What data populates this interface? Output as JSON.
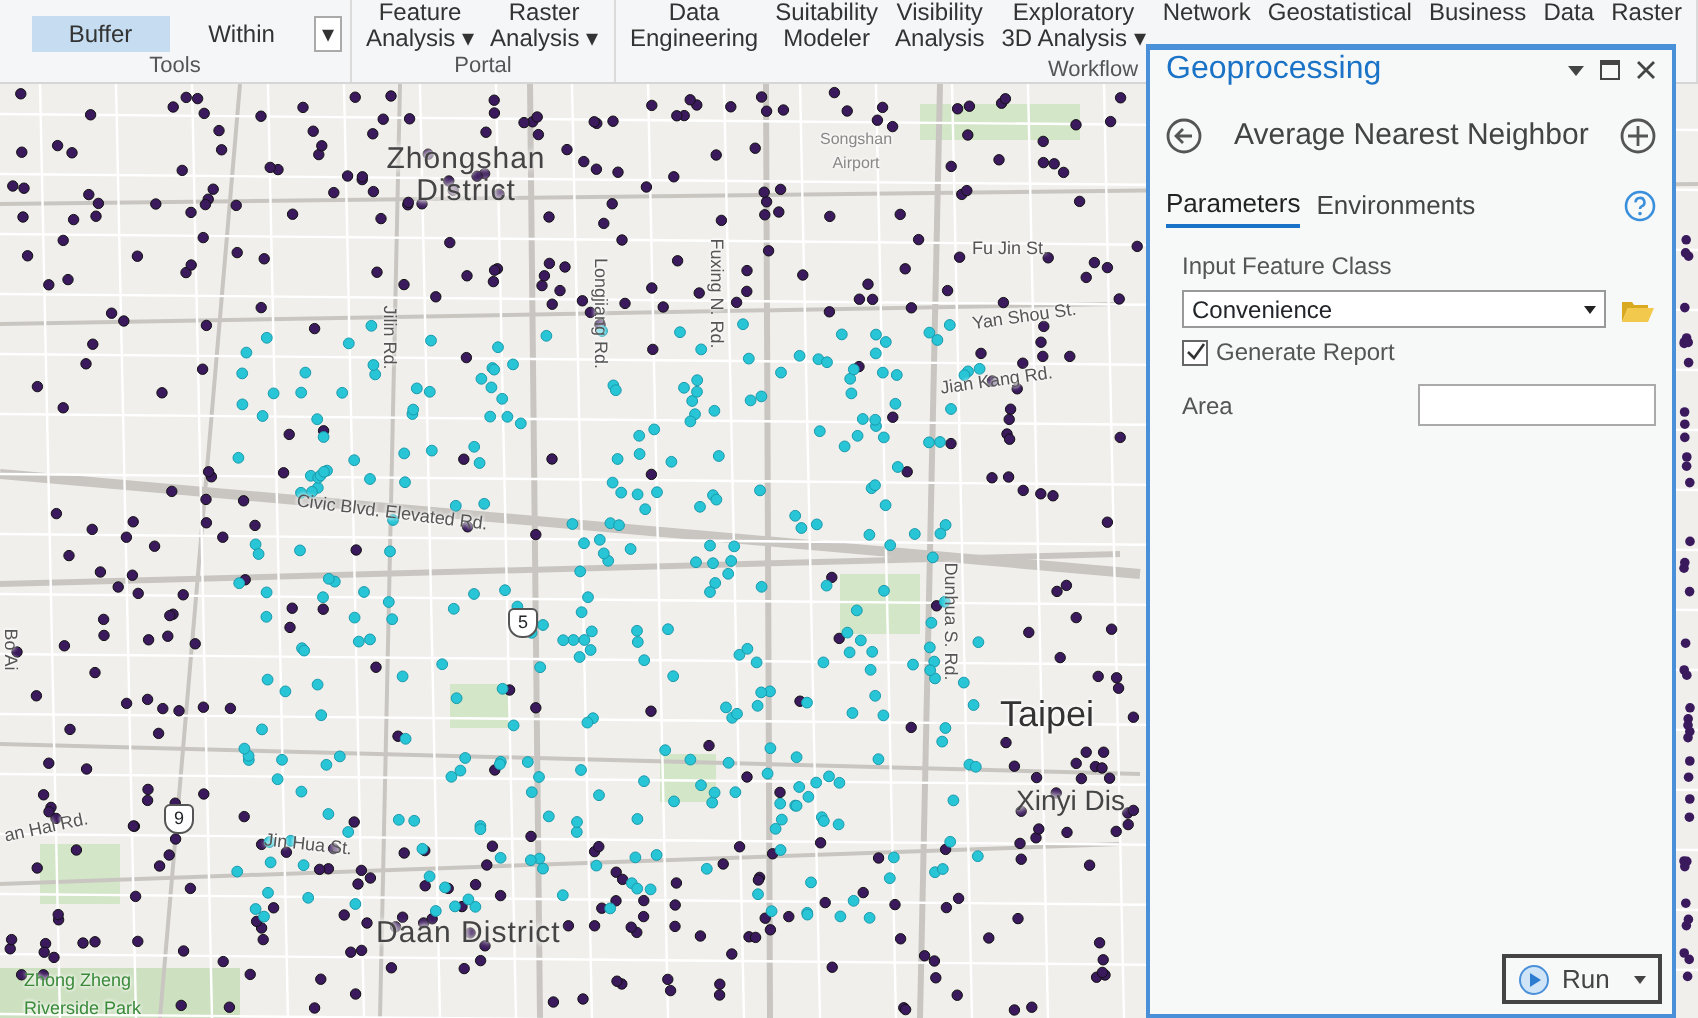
{
  "ribbon": {
    "groups": [
      {
        "label": "Tools",
        "buttons": [
          {
            "lines": [
              "Buffer"
            ],
            "selected": true
          },
          {
            "lines": [
              "Within"
            ],
            "selected": false
          }
        ],
        "gallery_more": "▾"
      },
      {
        "label": "Portal",
        "buttons": [
          {
            "lines": [
              "Feature",
              "Analysis ▾"
            ],
            "selected": false
          },
          {
            "lines": [
              "Raster",
              "Analysis ▾"
            ],
            "selected": false
          }
        ]
      },
      {
        "label": "Workflow",
        "buttons": [
          {
            "lines": [
              "Data",
              "Engineering"
            ],
            "selected": false
          },
          {
            "lines": [
              "Suitability",
              "Modeler"
            ],
            "selected": false
          },
          {
            "lines": [
              "Visibility",
              "Analysis"
            ],
            "selected": false
          },
          {
            "lines": [
              "Exploratory",
              "3D Analysis ▾"
            ],
            "selected": false
          },
          {
            "lines": [
              "Network"
            ],
            "selected": false
          },
          {
            "lines": [
              "Geostatistical"
            ],
            "selected": false
          },
          {
            "lines": [
              "Business"
            ],
            "selected": false
          },
          {
            "lines": [
              "Data"
            ],
            "selected": false
          },
          {
            "lines": [
              "Raster"
            ],
            "selected": false
          }
        ]
      }
    ]
  },
  "map": {
    "labels": [
      {
        "kind": "poi",
        "text": "Songshan Airport"
      },
      {
        "kind": "district",
        "text": "Zhongshan District"
      },
      {
        "kind": "street",
        "text": "Fu Jin St."
      },
      {
        "kind": "street",
        "text": "Yan Shou St."
      },
      {
        "kind": "street",
        "text": "Jian Kang Rd."
      },
      {
        "kind": "street",
        "text": "Civic Blvd. Elevated Rd."
      },
      {
        "kind": "street",
        "text": "Jilin Rd."
      },
      {
        "kind": "street",
        "text": "Longjiang Rd."
      },
      {
        "kind": "street",
        "text": "Fuxing N. Rd."
      },
      {
        "kind": "street",
        "text": "Dunhua S. Rd."
      },
      {
        "kind": "city",
        "text": "Taipei"
      },
      {
        "kind": "district",
        "text": "Xinyi Dis"
      },
      {
        "kind": "district",
        "text": "Daan District"
      },
      {
        "kind": "street",
        "text": "Jin Hua St."
      },
      {
        "kind": "park",
        "text": "Zhong Zheng Riverside Park"
      },
      {
        "kind": "street",
        "text": "an Hai Rd."
      },
      {
        "kind": "street",
        "text": "Bo Ai"
      }
    ],
    "shields": [
      "5",
      "9"
    ]
  },
  "panel": {
    "title": "Geoprocessing",
    "tool": "Average Nearest Neighbor",
    "tabs": [
      {
        "label": "Parameters",
        "selected": true
      },
      {
        "label": "Environments",
        "selected": false
      }
    ],
    "params": [
      {
        "kind": "dropdown",
        "label": "Input Feature Class",
        "value": "Convenience"
      },
      {
        "kind": "checkbox",
        "label": "Generate Report",
        "checked": true
      },
      {
        "kind": "text",
        "label": "Area"
      }
    ],
    "run": "Run"
  }
}
